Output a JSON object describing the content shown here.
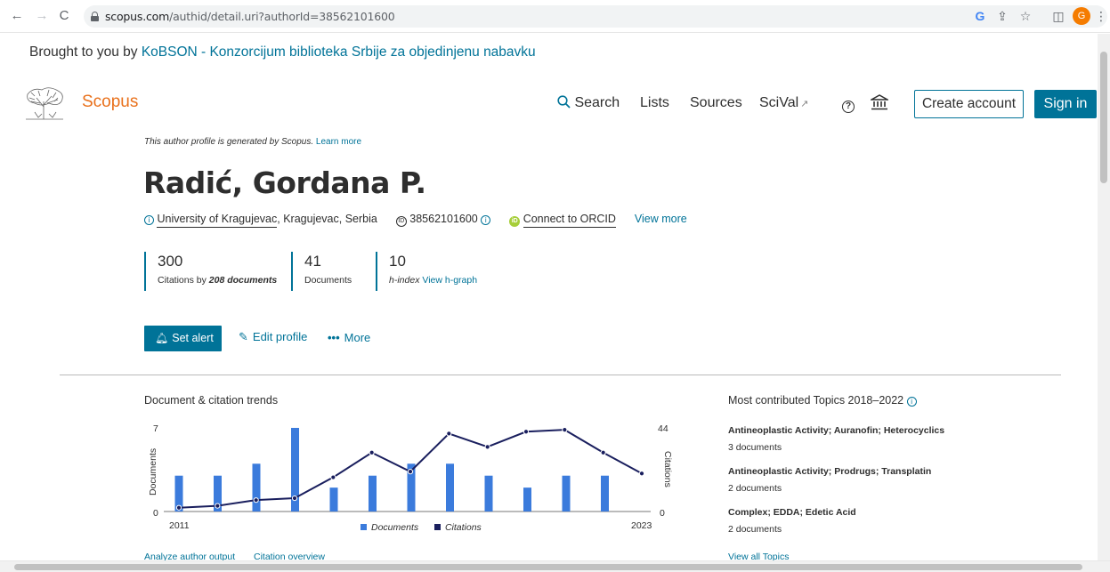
{
  "browser": {
    "url_domain": "scopus.com",
    "url_path": "/authid/detail.uri?authorId=38562101600",
    "avatar_letter": "G"
  },
  "brought_prefix": "Brought to you by",
  "brought_link": "KoBSON - Konzorcijum biblioteka Srbije za objedinjenu nabavku",
  "header": {
    "brand": "Scopus",
    "nav": [
      "Search",
      "Lists",
      "Sources",
      "SciVal"
    ],
    "create_account": "Create account",
    "sign_in": "Sign in"
  },
  "profile": {
    "note": "This author profile is generated by Scopus.",
    "note_link": "Learn more",
    "name": "Radić, Gordana P.",
    "institution": "University of Kragujevac",
    "location": ", Kragujevac, Serbia",
    "author_id": "38562101600",
    "orcid": "Connect to ORCID",
    "view_more": "View more"
  },
  "metrics": {
    "citations": "300",
    "citations_label_prefix": "Citations by",
    "citations_label_docs": "208 documents",
    "documents": "41",
    "documents_label": "Documents",
    "hindex": "10",
    "hindex_label": "h-index",
    "hgraph_link": "View h-graph"
  },
  "actions": {
    "set_alert": "Set alert",
    "edit_profile": "Edit profile",
    "more": "More"
  },
  "trend": {
    "title": "Document & citation trends",
    "analyze": "Analyze author output",
    "overview": "Citation overview"
  },
  "chart_data": {
    "type": "bar+line",
    "x_start": "2011",
    "x_end": "2023",
    "ylabel_left": "Documents",
    "ylabel_right": "Citations",
    "ylim_left": [
      0,
      7
    ],
    "ylim_right": [
      0,
      44
    ],
    "left_ticks": [
      "7",
      "0"
    ],
    "right_ticks": [
      "44",
      "0"
    ],
    "series": [
      {
        "name": "Documents",
        "type": "bar",
        "values": [
          3,
          3,
          4,
          7,
          2,
          3,
          4,
          4,
          3,
          2,
          3,
          3
        ]
      },
      {
        "name": "Citations",
        "type": "line",
        "values": [
          2,
          3,
          6,
          7,
          18,
          31,
          21,
          41,
          34,
          42,
          43,
          31,
          20
        ]
      }
    ],
    "legend_position": "bottom"
  },
  "topics": {
    "title": "Most contributed Topics 2018–2022",
    "items": [
      {
        "name": "Antineoplastic Activity; Auranofin; Heterocyclics",
        "docs": "3 documents"
      },
      {
        "name": "Antineoplastic Activity; Prodrugs; Transplatin",
        "docs": "2 documents"
      },
      {
        "name": "Complex; EDDA; Edetic Acid",
        "docs": "2 documents"
      }
    ],
    "view_all": "View all Topics"
  },
  "colors": {
    "accent": "#007398",
    "brand": "#e9711c",
    "bars": "#3b7bdc",
    "line": "#1a1f5e"
  }
}
